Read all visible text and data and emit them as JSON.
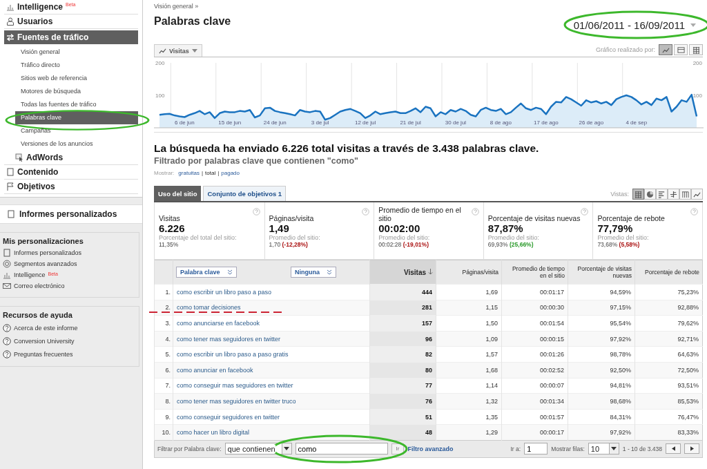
{
  "sidebar": {
    "nav": [
      {
        "label": "Intelligence",
        "badge": "Beta",
        "kind": "section",
        "selected": false
      },
      {
        "label": "Usuarios",
        "kind": "section",
        "selected": false
      },
      {
        "label": "Fuentes de tráfico",
        "kind": "section",
        "selected": true,
        "children": [
          {
            "label": "Visión general",
            "selected": false,
            "circled": false
          },
          {
            "label": "Tráfico directo",
            "selected": false,
            "circled": false
          },
          {
            "label": "Sitios web de referencia",
            "selected": false,
            "circled": false
          },
          {
            "label": "Motores de búsqueda",
            "selected": false,
            "circled": false
          },
          {
            "label": "Todas las fuentes de tráfico",
            "selected": false,
            "circled": false
          },
          {
            "label": "Palabras clave",
            "selected": true,
            "circled": true
          },
          {
            "label": "Campañas",
            "selected": false,
            "circled": false
          },
          {
            "label": "Versiones de los anuncios",
            "selected": false,
            "circled": false
          }
        ]
      },
      {
        "label": "AdWords",
        "kind": "indented",
        "selected": false
      },
      {
        "label": "Contenido",
        "kind": "section",
        "selected": false
      },
      {
        "label": "Objetivos",
        "kind": "section",
        "selected": false
      }
    ],
    "custom_reports": "Informes personalizados",
    "panels": [
      {
        "title": "Mis personalizaciones",
        "items": [
          {
            "label": "Informes personalizados"
          },
          {
            "label": "Segmentos avanzados"
          },
          {
            "label": "Intelligence",
            "badge": "Beta"
          },
          {
            "label": "Correo electrónico"
          }
        ]
      },
      {
        "title": "Recursos de ayuda",
        "items": [
          {
            "label": "Acerca de este informe"
          },
          {
            "label": "Conversion University"
          },
          {
            "label": "Preguntas frecuentes"
          }
        ]
      }
    ]
  },
  "header": {
    "breadcrumb": "Visión general »",
    "title": "Palabras clave",
    "date_range": {
      "text": "01/06/2011 - 16/09/2011",
      "circled": true
    }
  },
  "chart": {
    "chart_by_label": "Gráfico realizado por:",
    "modes": [
      {
        "kind": "line",
        "selected": true
      },
      {
        "kind": "bar",
        "selected": false
      },
      {
        "kind": "list",
        "selected": false
      }
    ],
    "right_ticks": [
      "200",
      "100"
    ],
    "chart_data": {
      "type": "area",
      "ylim": [
        0,
        200
      ],
      "yticks": [
        {
          "value": 100,
          "label": "100"
        },
        {
          "value": 200,
          "label": "200"
        }
      ],
      "categories": [
        null,
        null,
        null,
        null,
        null,
        "6 de jun",
        null,
        null,
        null,
        null,
        null,
        null,
        null,
        null,
        "15 de jun",
        null,
        null,
        null,
        null,
        null,
        null,
        null,
        null,
        "24 de jun",
        null,
        null,
        null,
        null,
        null,
        null,
        null,
        null,
        "3 de jul",
        null,
        null,
        null,
        null,
        null,
        null,
        null,
        null,
        "12 de jul",
        null,
        null,
        null,
        null,
        null,
        null,
        null,
        null,
        "21 de jul",
        null,
        null,
        null,
        null,
        null,
        null,
        null,
        null,
        "30 de jul",
        null,
        null,
        null,
        null,
        null,
        null,
        null,
        null,
        "8 de ago",
        null,
        null,
        null,
        null,
        null,
        null,
        null,
        null,
        "17 de ago",
        null,
        null,
        null,
        null,
        null,
        null,
        null,
        null,
        "26 de ago",
        null,
        null,
        null,
        null,
        null,
        null,
        null,
        null,
        "4 de sep",
        null,
        null,
        null,
        null,
        null,
        null,
        null,
        null,
        null,
        null,
        null,
        null
      ],
      "series": [
        {
          "name": "Visitas",
          "color": "#1a73c0",
          "values": [
            40,
            42,
            43,
            38,
            35,
            33,
            40,
            45,
            52,
            42,
            48,
            30,
            45,
            50,
            48,
            48,
            52,
            50,
            55,
            32,
            38,
            60,
            62,
            52,
            48,
            45,
            42,
            38,
            55,
            50,
            48,
            52,
            50,
            25,
            30,
            40,
            50,
            55,
            58,
            52,
            45,
            30,
            38,
            50,
            42,
            45,
            48,
            50,
            45,
            45,
            52,
            60,
            48,
            65,
            60,
            35,
            48,
            42,
            55,
            50,
            58,
            52,
            40,
            35,
            55,
            62,
            55,
            52,
            58,
            42,
            48,
            62,
            75,
            60,
            55,
            62,
            58,
            42,
            65,
            80,
            78,
            95,
            88,
            78,
            68,
            85,
            78,
            82,
            75,
            80,
            70,
            88,
            95,
            100,
            95,
            85,
            72,
            80,
            70,
            90,
            85,
            95,
            50,
            65,
            85,
            80,
            102,
            35
          ]
        }
      ]
    }
  },
  "summary": {
    "headline": "La búsqueda ha enviado 6.226 total visitas a través de 3.438 palabras clave.",
    "filter_note": "Filtrado por palabras clave que contienen \"como\"",
    "show_label": "Mostrar:",
    "separator": "|",
    "show_options": [
      {
        "label": "gratuitas",
        "selected": false
      },
      {
        "label": "total",
        "selected": true
      },
      {
        "label": "pagado",
        "selected": false
      }
    ]
  },
  "tabs": [
    {
      "label": "Uso del sitio",
      "selected": true
    },
    {
      "label": "Conjunto de objetivos 1",
      "selected": false
    }
  ],
  "views_label": "Vistas:",
  "views": [
    {
      "kind": "table",
      "selected": true
    },
    {
      "kind": "pie",
      "selected": false
    },
    {
      "kind": "bars",
      "selected": false
    },
    {
      "kind": "compare",
      "selected": false
    },
    {
      "kind": "pivot",
      "selected": false
    },
    {
      "kind": "trend",
      "selected": false
    }
  ],
  "metrics": [
    {
      "label": "Visitas",
      "value": "6.226",
      "site_label": "Porcentaje del total del sitio:",
      "site_value": "11,35%"
    },
    {
      "label": "Páginas/visita",
      "value": "1,49",
      "site_label": "Promedio del sitio:",
      "site_value": "1,70",
      "change": "(-12,28%)",
      "color": "#aa1111"
    },
    {
      "label": "Promedio de tiempo en el sitio",
      "value": "00:02:00",
      "site_label": "Promedio del sitio:",
      "site_value": "00:02:28",
      "change": "(-19,01%)",
      "color": "#aa1111"
    },
    {
      "label": "Porcentaje de visitas nuevas",
      "value": "87,87%",
      "site_label": "Promedio del sitio:",
      "site_value": "69,93%",
      "change": "(25,66%)",
      "color": "#2a9a2a"
    },
    {
      "label": "Porcentaje de rebote",
      "value": "77,79%",
      "site_label": "Promedio del sitio:",
      "site_value": "73,68%",
      "change": "(5,58%)",
      "color": "#aa1111"
    }
  ],
  "table": {
    "dimension_select": "Palabra clave",
    "secondary_select": "Ninguna",
    "columns": [
      {
        "label": "Visitas",
        "sorted": true
      },
      {
        "label": "Páginas/visita",
        "sorted": false
      },
      {
        "label": "Promedio de tiempo en el sitio",
        "sorted": false
      },
      {
        "label": "Porcentaje de visitas nuevas",
        "sorted": false
      },
      {
        "label": "Porcentaje de rebote",
        "sorted": false
      }
    ],
    "rows": [
      {
        "index": "1.",
        "keyword": "como escribir un libro paso a paso",
        "cells": [
          "444",
          "1,69",
          "00:01:17",
          "94,59%",
          "75,23%"
        ],
        "struck": false
      },
      {
        "index": "2.",
        "keyword": "como tomar decisiones",
        "cells": [
          "281",
          "1,15",
          "00:00:30",
          "97,15%",
          "92,88%"
        ],
        "struck": true
      },
      {
        "index": "3.",
        "keyword": "como anunciarse en facebook",
        "cells": [
          "157",
          "1,50",
          "00:01:54",
          "95,54%",
          "79,62%"
        ],
        "struck": false
      },
      {
        "index": "4.",
        "keyword": "como tener mas seguidores en twitter",
        "cells": [
          "96",
          "1,09",
          "00:00:15",
          "97,92%",
          "92,71%"
        ],
        "struck": false
      },
      {
        "index": "5.",
        "keyword": "como escribir un libro paso a paso gratis",
        "cells": [
          "82",
          "1,57",
          "00:01:26",
          "98,78%",
          "64,63%"
        ],
        "struck": false
      },
      {
        "index": "6.",
        "keyword": "como anunciar en facebook",
        "cells": [
          "80",
          "1,68",
          "00:02:52",
          "92,50%",
          "72,50%"
        ],
        "struck": false
      },
      {
        "index": "7.",
        "keyword": "como conseguir mas seguidores en twitter",
        "cells": [
          "77",
          "1,14",
          "00:00:07",
          "94,81%",
          "93,51%"
        ],
        "struck": false
      },
      {
        "index": "8.",
        "keyword": "como tener mas seguidores en twitter truco",
        "cells": [
          "76",
          "1,32",
          "00:01:34",
          "98,68%",
          "85,53%"
        ],
        "struck": false
      },
      {
        "index": "9.",
        "keyword": "como conseguir seguidores en twitter",
        "cells": [
          "51",
          "1,35",
          "00:01:57",
          "84,31%",
          "76,47%"
        ],
        "struck": false
      },
      {
        "index": "10.",
        "keyword": "como hacer un libro digital",
        "cells": [
          "48",
          "1,29",
          "00:00:17",
          "97,92%",
          "83,33%"
        ],
        "struck": false
      }
    ]
  },
  "footer": {
    "filter_label": "Filtrar por Palabra clave:",
    "match_select": "que contienen",
    "filter_value": "como",
    "filter_circled": true,
    "go_button": "Ir",
    "advanced_link": "Filtro avanzado",
    "goto_label": "Ir a:",
    "goto_value": "1",
    "rows_label": "Mostrar filas:",
    "rows_value": "10",
    "range": "1 - 10 de 3.438"
  }
}
